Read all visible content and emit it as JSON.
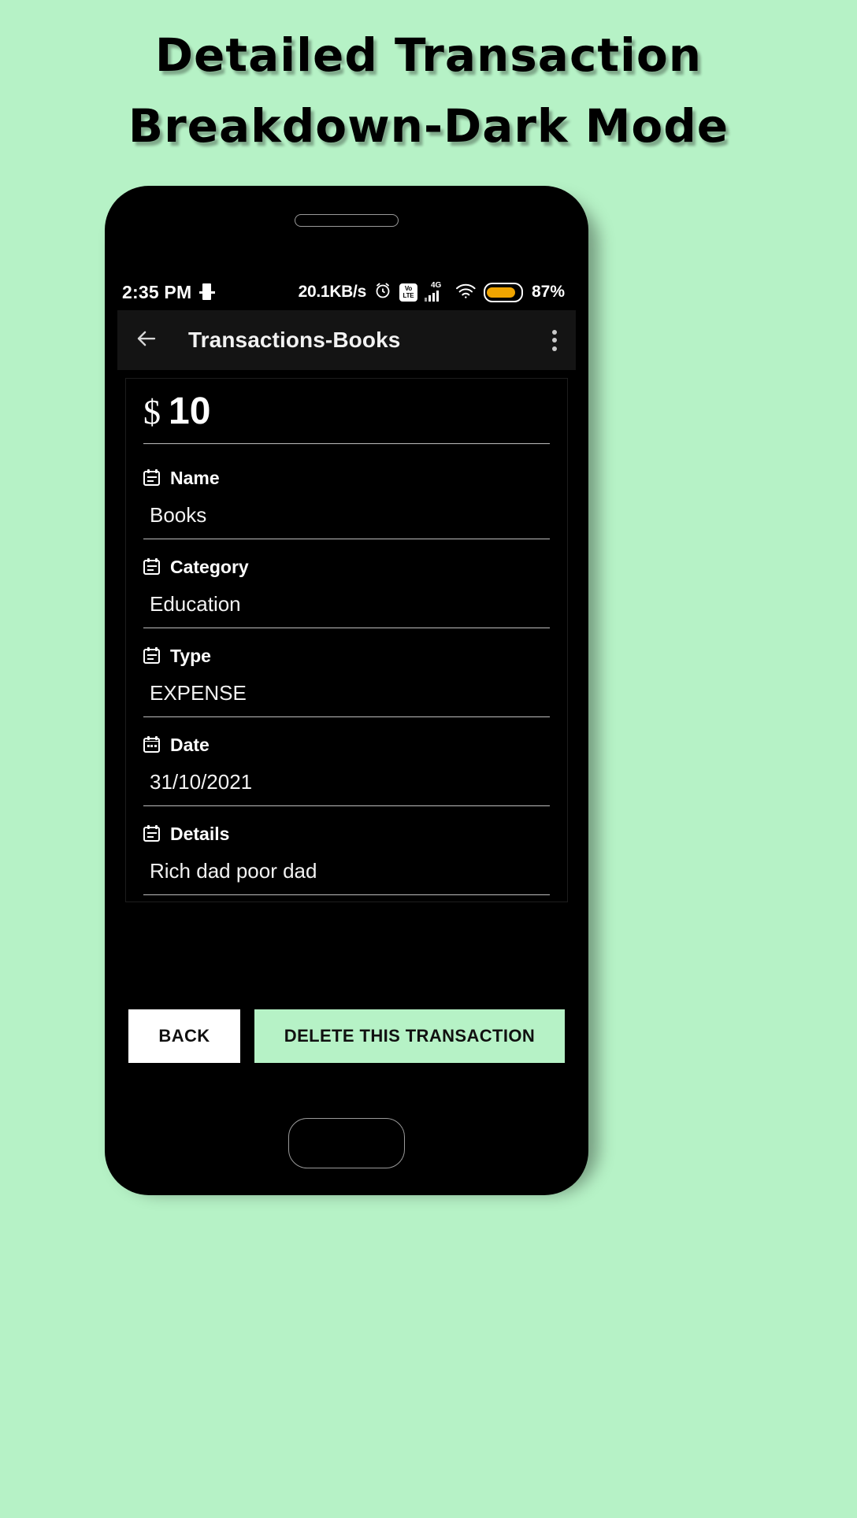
{
  "poster": {
    "title_line1": "Detailed Transaction",
    "title_line2": "Breakdown-Dark Mode",
    "background_color": "#b6f2c6"
  },
  "status_bar": {
    "time": "2:35 PM",
    "sim_icon": "sim-card-icon",
    "network_speed": "20.1KB/s",
    "alarm_icon": "alarm-clock-icon",
    "volte_top": "Vo",
    "volte_bottom": "LTE",
    "network_generation": "4G",
    "signal_icon": "signal-bars-icon",
    "wifi_icon": "wifi-icon",
    "battery_level": "87%",
    "battery_color": "#f0a500"
  },
  "app_bar": {
    "back_icon": "arrow-left-icon",
    "title": "Transactions-Books",
    "overflow_icon": "kebab-menu-icon"
  },
  "transaction": {
    "currency_symbol": "$",
    "amount": "10",
    "fields": [
      {
        "icon": "note-icon",
        "label": "Name",
        "value": "Books"
      },
      {
        "icon": "note-icon",
        "label": "Category",
        "value": "Education"
      },
      {
        "icon": "note-icon",
        "label": "Type",
        "value": "EXPENSE"
      },
      {
        "icon": "calendar-icon",
        "label": "Date",
        "value": "31/10/2021"
      },
      {
        "icon": "note-icon",
        "label": "Details",
        "value": "Rich dad poor dad"
      }
    ]
  },
  "actions": {
    "back_label": "BACK",
    "delete_label": "DELETE THIS TRANSACTION",
    "delete_color": "#b6f2c6",
    "back_color": "#ffffff"
  }
}
